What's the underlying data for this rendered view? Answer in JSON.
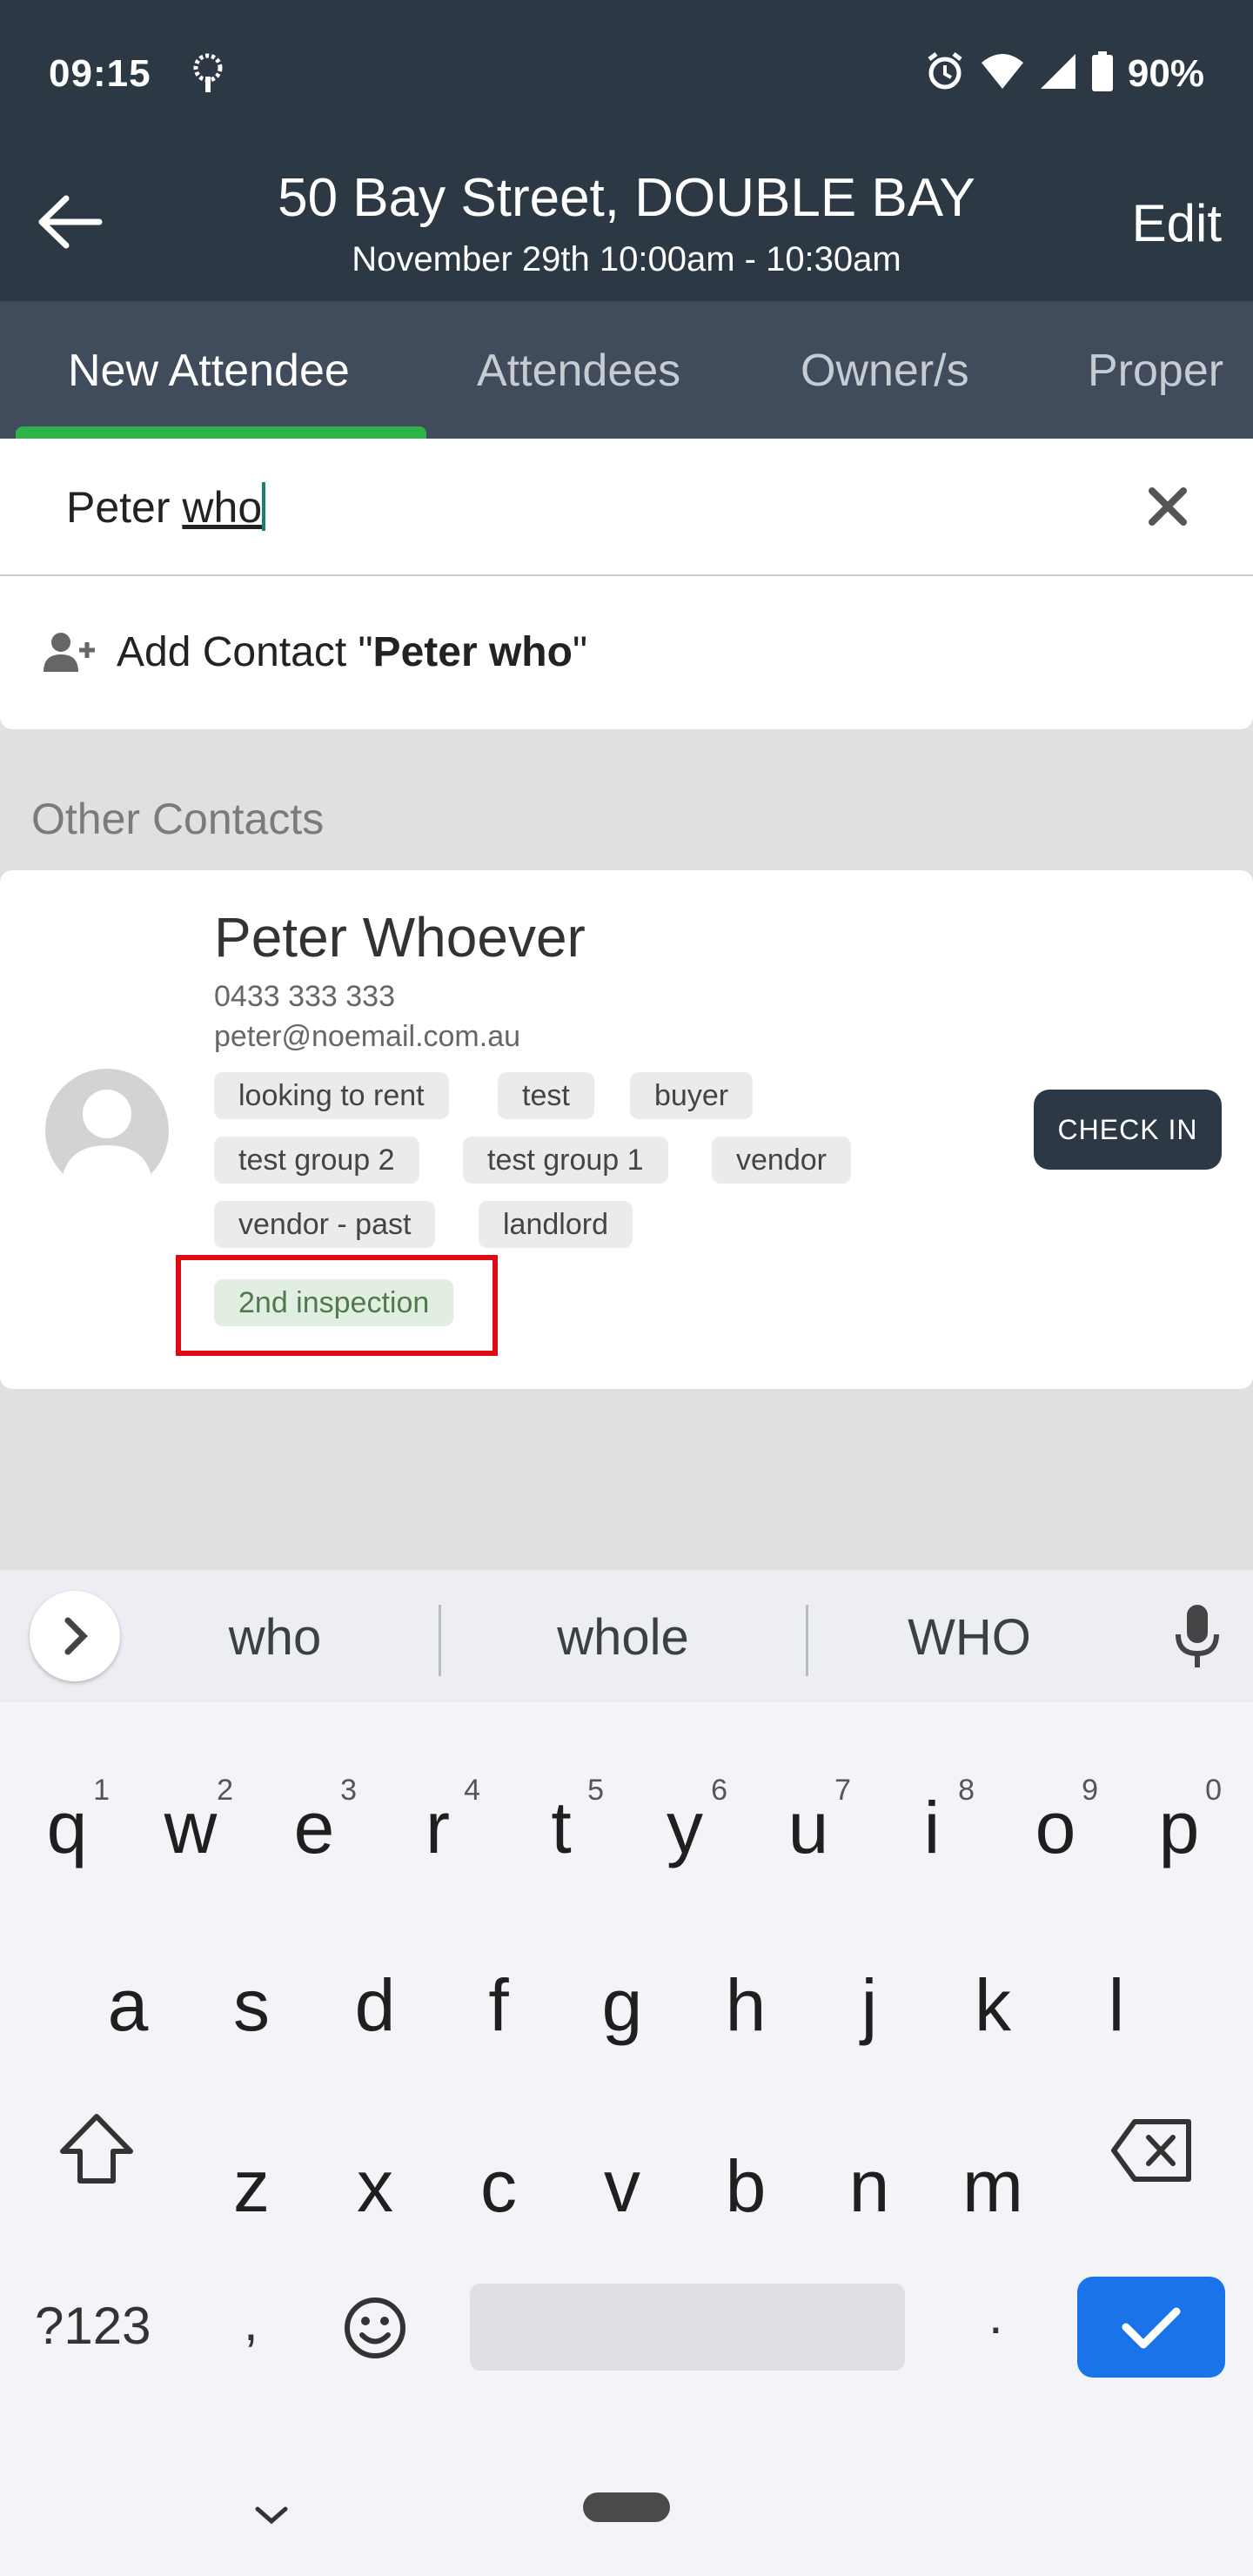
{
  "status_bar": {
    "time": "09:15",
    "battery": "90%"
  },
  "app_bar": {
    "title": "50 Bay Street, DOUBLE BAY",
    "subtitle": "November 29th 10:00am - 10:30am",
    "edit_label": "Edit"
  },
  "tabs": [
    {
      "label": "New Attendee",
      "active": true
    },
    {
      "label": "Attendees",
      "active": false
    },
    {
      "label": "Owner/s",
      "active": false
    },
    {
      "label": "Proper",
      "active": false
    }
  ],
  "search": {
    "value_plain": "Peter ",
    "value_underlined": "who"
  },
  "add_contact": {
    "prefix": "Add Contact \"",
    "name": "Peter who",
    "suffix": "\""
  },
  "section_title": "Other Contacts",
  "contact": {
    "name": "Peter Whoever",
    "phone": "0433 333 333",
    "email": "peter@noemail.com.au",
    "tags": [
      "looking to rent",
      "test",
      "buyer",
      "test group 2",
      "test group 1",
      "vendor",
      "vendor - past",
      "landlord"
    ],
    "highlight_tag": "2nd inspection",
    "checkin_label": "CHECK IN"
  },
  "keyboard": {
    "suggestions": [
      "who",
      "whole",
      "WHO"
    ],
    "row1": [
      "q",
      "w",
      "e",
      "r",
      "t",
      "y",
      "u",
      "i",
      "o",
      "p"
    ],
    "row1_digits": [
      "1",
      "2",
      "3",
      "4",
      "5",
      "6",
      "7",
      "8",
      "9",
      "0"
    ],
    "row2": [
      "a",
      "s",
      "d",
      "f",
      "g",
      "h",
      "j",
      "k",
      "l"
    ],
    "row3": [
      "z",
      "x",
      "c",
      "v",
      "b",
      "n",
      "m"
    ],
    "symbols_label": "?123",
    "comma": ",",
    "period": "."
  },
  "colors": {
    "header": "#2d3845",
    "tabs": "#404c5c",
    "accent": "#2db34a",
    "highlight": "#e00a14",
    "enter": "#1a73e8"
  }
}
